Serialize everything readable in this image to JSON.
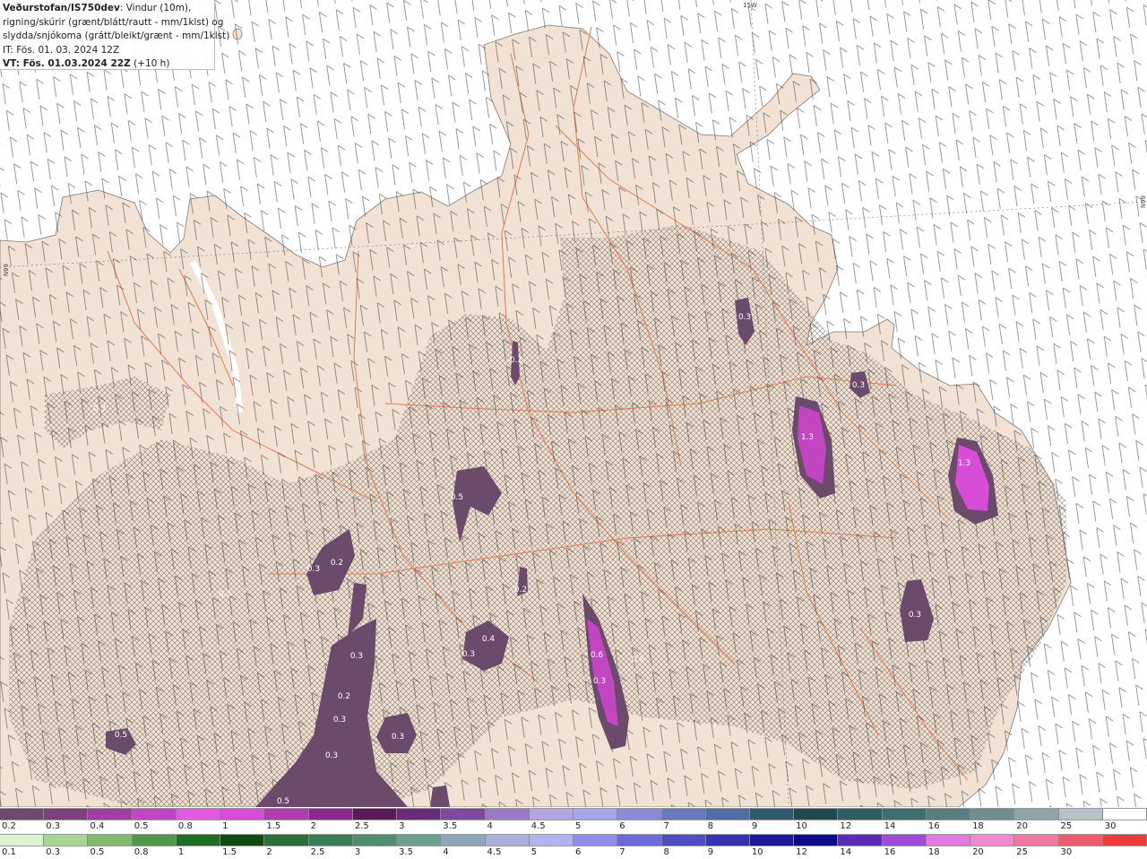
{
  "header": {
    "brand": "Veðurstofan/IS750dev",
    "line1_rest": ": Vindur (10m),",
    "line2": "rigning/skúrir (grænt/blátt/rautt - mm/1klst) og",
    "line3": "slydda/snjókoma (grátt/bleikt/grænt - mm/1klst)",
    "it": "IT: Fös. 01. 03. 2024 12Z",
    "vt_bold": "VT: Fös. 01.03.2024 22Z",
    "vt_rest": " (+10 h)"
  },
  "graticule": {
    "top_label": "15W",
    "left_label": "66N",
    "right_label": "66N"
  },
  "map_values": [
    "0.3",
    "0.2",
    "0.3",
    "1.3",
    "0.3",
    "1.3",
    "0.5",
    "0.2",
    "0.3",
    "0.2",
    "0.3",
    "0.3",
    "0.4",
    "0.6",
    "0.6",
    "0.3",
    "0.3",
    "0.3",
    "0.2",
    "0.3",
    "0.3",
    "0.5"
  ],
  "legend_snow": {
    "labels": [
      "0.2",
      "0.3",
      "0.4",
      "0.5",
      "0.8",
      "1",
      "1.5",
      "2",
      "2.5",
      "3",
      "3.5",
      "4",
      "4.5",
      "5",
      "6",
      "7",
      "8",
      "9",
      "10",
      "12",
      "14",
      "16",
      "18",
      "20",
      "25",
      "30"
    ],
    "colors": [
      "#6b4a6b",
      "#7e3f7e",
      "#a13fa1",
      "#c246c2",
      "#e15be1",
      "#d84dd8",
      "#b03cb0",
      "#8c2a8c",
      "#5a1a5a",
      "#6a2c7a",
      "#7e4aa0",
      "#9a7ac4",
      "#b4a4e0",
      "#a6a6e8",
      "#8a8ad8",
      "#6a78c0",
      "#4e6fa6",
      "#2e5a6e",
      "#1e4a50",
      "#2e5e62",
      "#3e6e70",
      "#557e80",
      "#6e8e90",
      "#8ea4a6",
      "#b6c2c4",
      "#ffffff"
    ]
  },
  "legend_rain": {
    "labels": [
      "0.1",
      "0.3",
      "0.5",
      "0.8",
      "1",
      "1.5",
      "2",
      "2.5",
      "3",
      "3.5",
      "4",
      "4.5",
      "5",
      "6",
      "7",
      "8",
      "9",
      "10",
      "12",
      "14",
      "16",
      "18",
      "20",
      "25",
      "30"
    ],
    "colors": [
      "#d8f4d0",
      "#a6d892",
      "#7ebc6a",
      "#4e9a48",
      "#1e6e22",
      "#0e4a12",
      "#2a6e3a",
      "#3a7e56",
      "#4e8e6e",
      "#6e9e8e",
      "#8ea6b8",
      "#a6b0d8",
      "#b0b4f0",
      "#8e8ee8",
      "#6a6ad8",
      "#4e4ec0",
      "#3434b0",
      "#1a1aa0",
      "#0a0a8e",
      "#5a2ab8",
      "#a04ad8",
      "#e07ae0",
      "#f08ad0",
      "#f07aa0",
      "#f05a70",
      "#f03a3a"
    ]
  }
}
